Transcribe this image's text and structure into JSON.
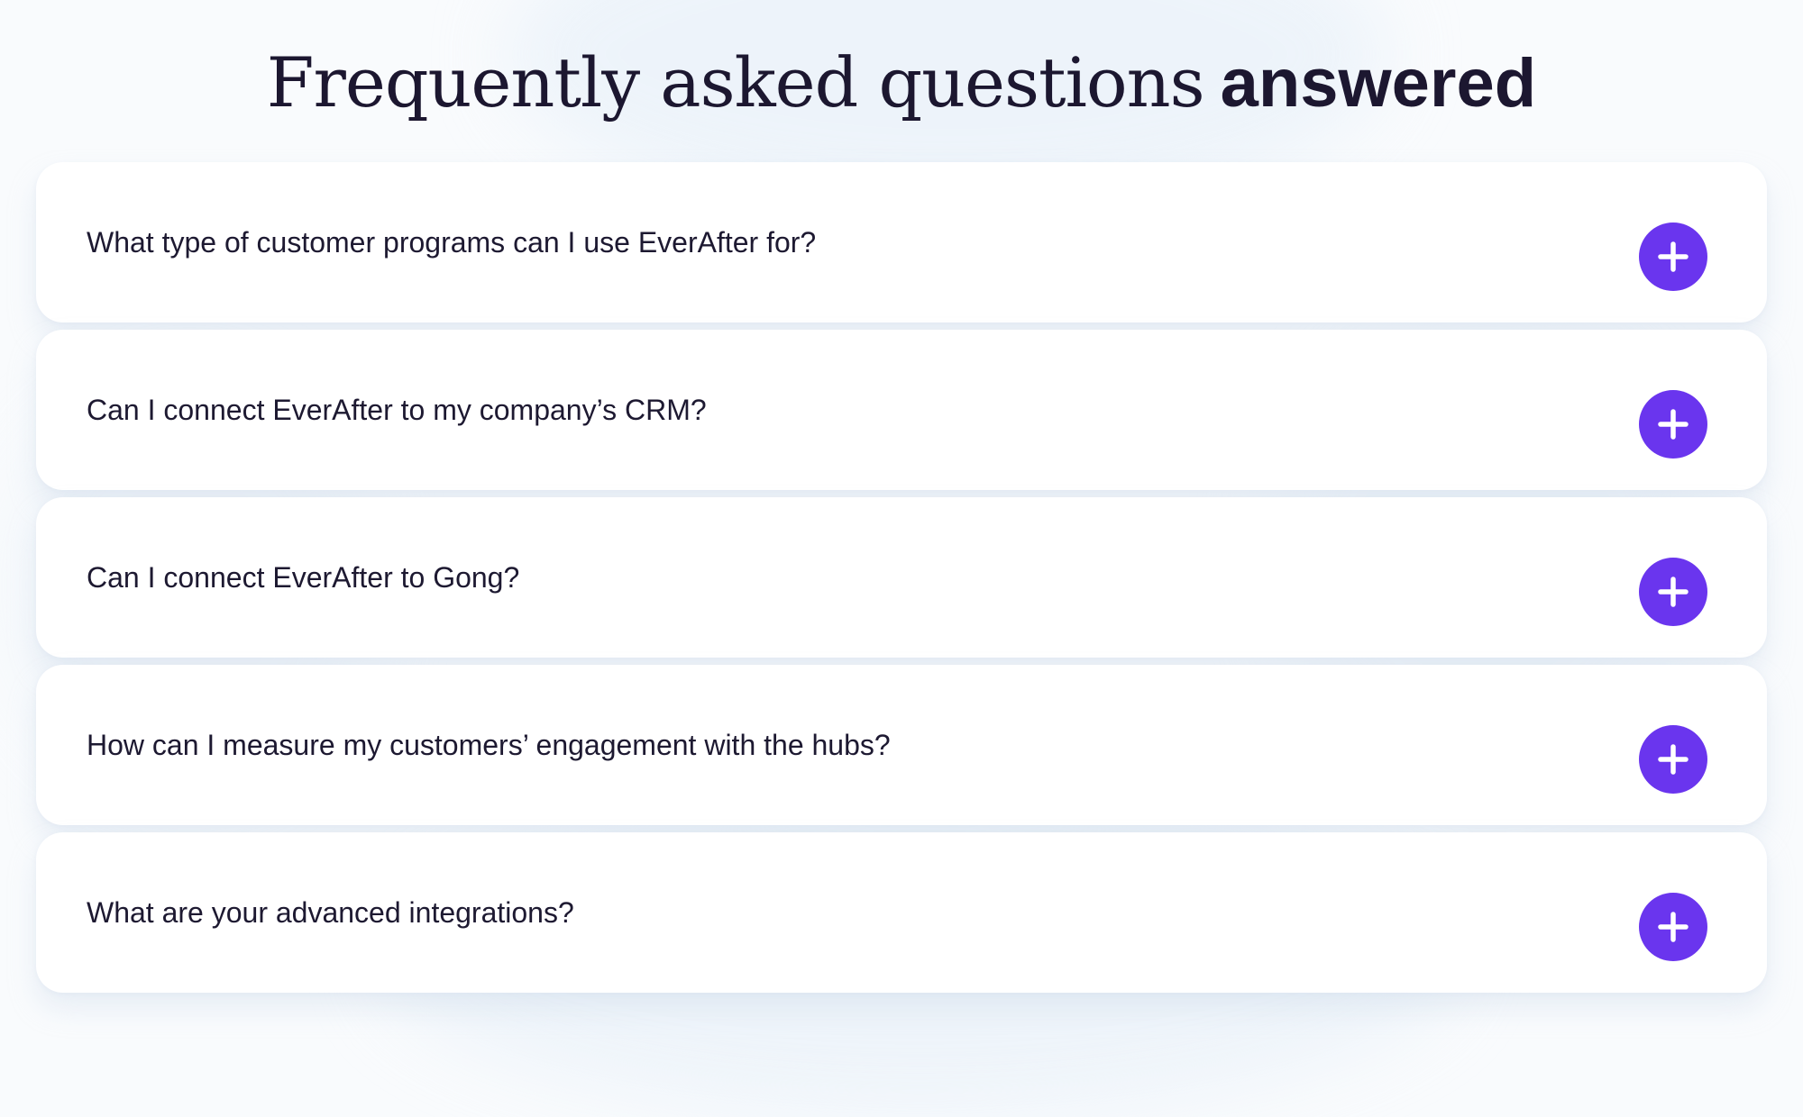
{
  "faq": {
    "title_light": "Frequently asked questions",
    "title_bold": "answered",
    "accent_color": "#6a35ee",
    "toggle_icon": "plus-icon",
    "items": [
      {
        "question": "What type of customer programs can I use EverAfter for?"
      },
      {
        "question": "Can I connect EverAfter to my company’s CRM?"
      },
      {
        "question": "Can I connect EverAfter to Gong?"
      },
      {
        "question": "How can I measure my customers’ engagement with the hubs?"
      },
      {
        "question": "What are your advanced integrations?"
      }
    ]
  }
}
